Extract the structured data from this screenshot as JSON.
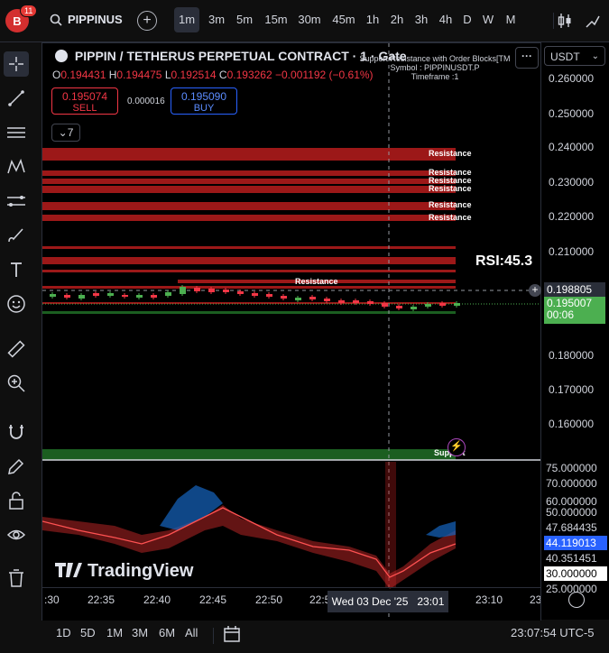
{
  "topbar": {
    "logo_letter": "B",
    "logo_badge": "11",
    "symbol": "PIPPINUS",
    "timeframes": [
      "1m",
      "3m",
      "5m",
      "15m",
      "30m",
      "45m",
      "1h",
      "2h",
      "3h",
      "4h",
      "D",
      "W",
      "M"
    ],
    "active_timeframe": "1m"
  },
  "legend": {
    "title": "PIPPIN / TETHERUS PERPETUAL CONTRACT · 1 · Gate",
    "open_label": "O",
    "open": "0.194431",
    "high_label": "H",
    "high": "0.194475",
    "low_label": "L",
    "low": "0.192514",
    "close_label": "C",
    "close": "0.193262",
    "change": "−0.001192 (−0.61%)",
    "sell_price": "0.195074",
    "sell_label": "SELL",
    "spread": "0.000016",
    "buy_price": "0.195090",
    "buy_label": "BUY",
    "indicators_count": "7"
  },
  "indicator_overlay": {
    "line1": "Support Resistance with Order Blocks[TM",
    "line2": "Symbol : PIPPINUSDT.P",
    "line3": "Timeframe :1"
  },
  "zones": {
    "resistance_label": "Resistance",
    "support_label": "Support"
  },
  "rsi_readout": "RSI:45.3",
  "price_scale": {
    "currency": "USDT",
    "levels": [
      "0.260000",
      "0.250000",
      "0.240000",
      "0.230000",
      "0.220000",
      "0.210000",
      "0.180000",
      "0.170000",
      "0.160000"
    ],
    "crosshair_price": "0.198805",
    "last_price": "0.195007",
    "countdown": "00:06"
  },
  "rsi_scale": {
    "levels": [
      "75.000000",
      "70.000000",
      "60.000000",
      "50.000000",
      "47.684435",
      "44.119013",
      "40.351451",
      "30.000000",
      "25.000000"
    ]
  },
  "watermark": "TradingView",
  "time_axis": {
    "ticks": [
      ":30",
      "22:35",
      "22:40",
      "22:45",
      "22:50",
      "22:5",
      "23:10",
      "23:"
    ],
    "crosshair_label": "Wed 03 Dec '25   23:01"
  },
  "bottombar": {
    "ranges": [
      "1D",
      "5D",
      "1M",
      "3M",
      "6M",
      "All"
    ],
    "clock": "23:07:54 UTC-5"
  },
  "colors": {
    "background": "#000000",
    "up": "#4caf50",
    "down": "#f23645",
    "resistance": "#b71c1c",
    "support": "#1b5e20",
    "accent": "#2962ff"
  }
}
